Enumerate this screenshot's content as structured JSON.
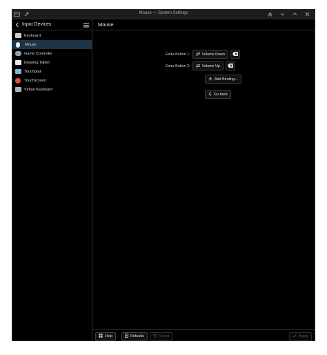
{
  "window": {
    "title": "Mouse — System Settings"
  },
  "sidebar": {
    "title": "Input Devices",
    "items": [
      {
        "label": "Keyboard",
        "icon": "keyboard-icon",
        "color": "#c8ccd0"
      },
      {
        "label": "Mouse",
        "icon": "mouse-icon",
        "color": "#e8eaec",
        "active": true
      },
      {
        "label": "Game Controller",
        "icon": "game-controller-icon",
        "color": "#9aa0a6"
      },
      {
        "label": "Drawing Tablet",
        "icon": "drawing-tablet-icon",
        "color": "#e6e8ea"
      },
      {
        "label": "Touchpad",
        "icon": "touchpad-icon",
        "color": "#7fb3d5"
      },
      {
        "label": "Touchscreen",
        "icon": "touchscreen-icon",
        "color": "#e74c3c"
      },
      {
        "label": "Virtual Keyboard",
        "icon": "virtual-keyboard-icon",
        "color": "#b0b4b8"
      }
    ]
  },
  "main": {
    "title": "Mouse",
    "bindings": [
      {
        "label": "Extra Button 1:",
        "action": "Volume Down"
      },
      {
        "label": "Extra Button 2:",
        "action": "Volume Up"
      }
    ],
    "add_binding_label": "Add Binding…",
    "go_back_label": "Go back"
  },
  "footer": {
    "help_label": "Help",
    "defaults_label": "Defaults",
    "reset_label": "Reset",
    "apply_label": "Apply"
  },
  "colors": {
    "accent": "#1d3446",
    "background": "#000000",
    "border": "#2d3136"
  }
}
